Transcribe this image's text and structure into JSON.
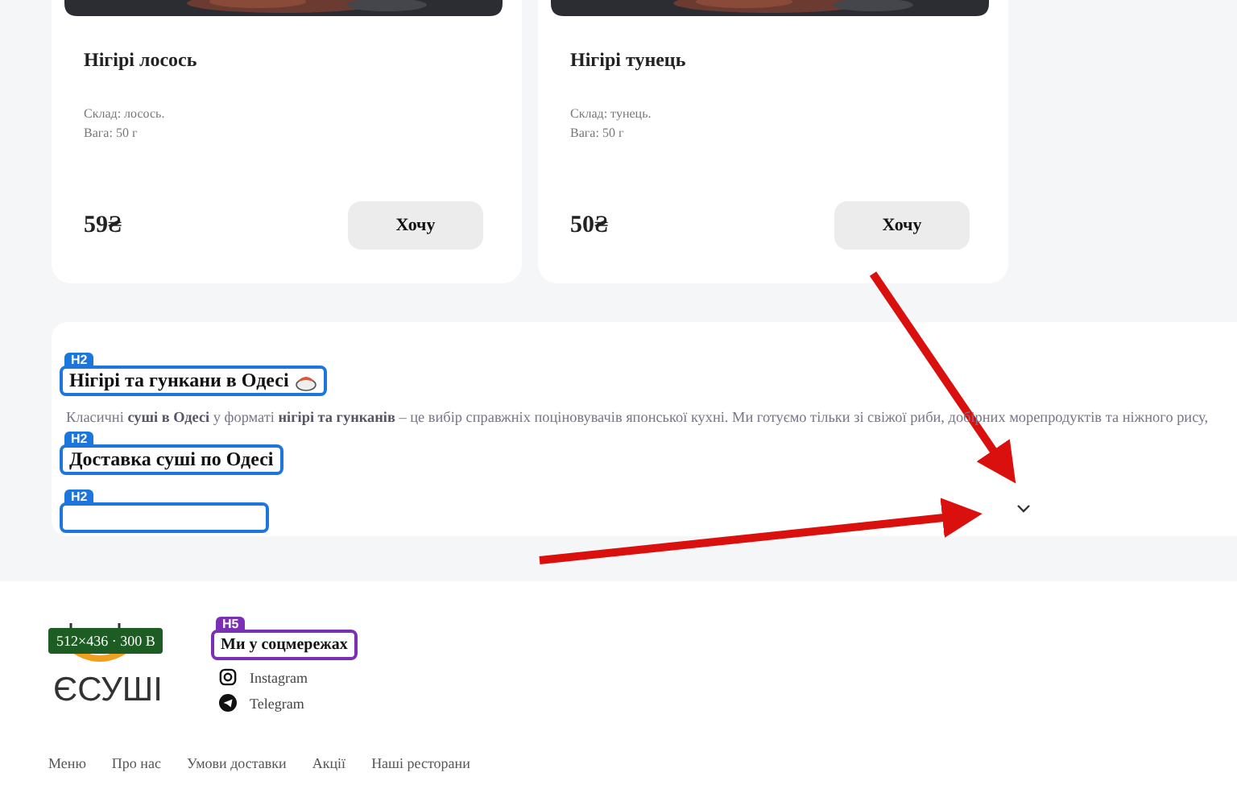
{
  "cards": [
    {
      "name": "Нігірі лосось",
      "composition": "Склад: лосось.",
      "weight": "Вага: 50 г",
      "price": "59₴",
      "button": "Хочу"
    },
    {
      "name": "Нігірі тунець",
      "composition": "Склад: тунець.",
      "weight": "Вага: 50 г",
      "price": "50₴",
      "button": "Хочу"
    }
  ],
  "seo": {
    "blocks": [
      {
        "tag": "H2",
        "heading": "Нігірі та гункани в Одесі",
        "emoji": true,
        "text": "Класичні **суші в Одесі** у форматі **нігірі та гунканів** – це вибір справжніх поціновувачів японської кухні. Ми готуємо тільки зі свіжої риби, добірних морепродуктів та ніжного рису,"
      },
      {
        "tag": "H2",
        "heading": "Доставка суші по Одесі",
        "emoji": false
      },
      {
        "tag": "H2",
        "emoji": false
      }
    ]
  },
  "footer": {
    "image_badge": "512×436 · 300 B",
    "logo": "ЄСУШІ",
    "social": {
      "tag": "H5",
      "heading": "Ми у соцмережах",
      "links": [
        {
          "kind": "instagram",
          "label": "Instagram"
        },
        {
          "kind": "telegram",
          "label": "Telegram"
        }
      ]
    },
    "nav": [
      "Меню",
      "Про нас",
      "Умови доставки",
      "Акції",
      "Наші ресторани"
    ]
  }
}
